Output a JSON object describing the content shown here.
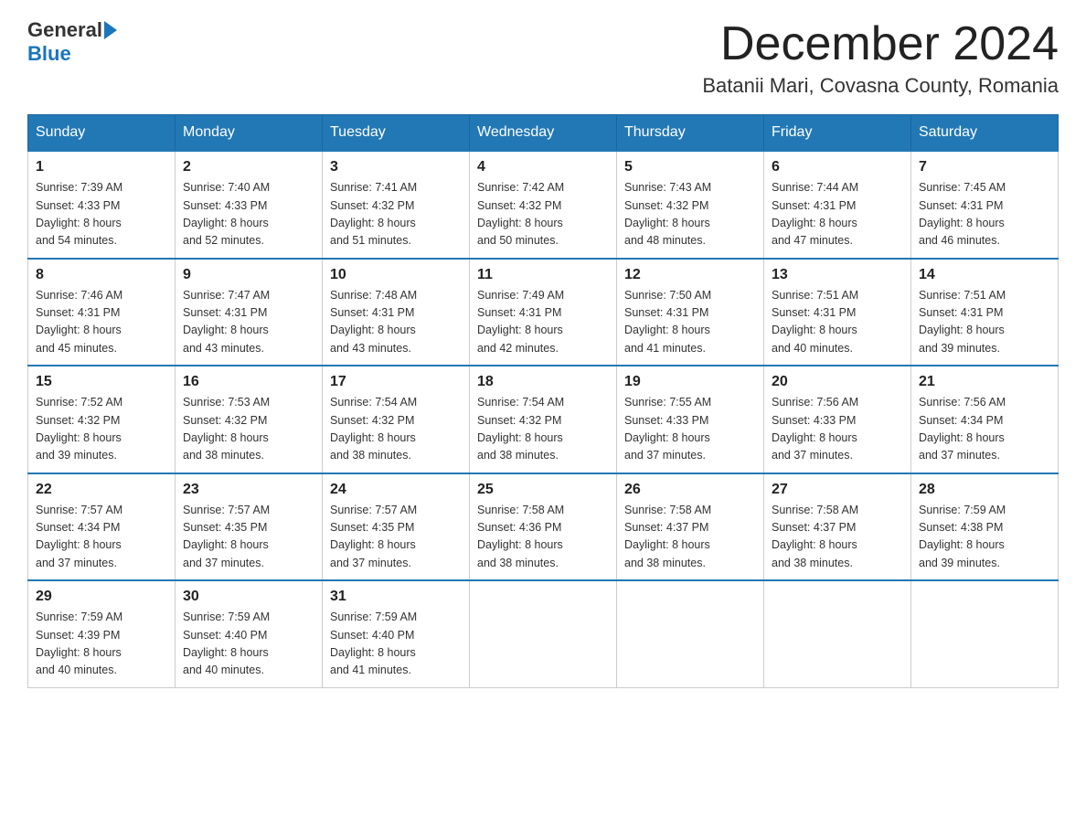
{
  "header": {
    "logo_general": "General",
    "logo_blue": "Blue",
    "month_title": "December 2024",
    "location": "Batanii Mari, Covasna County, Romania"
  },
  "days_of_week": [
    "Sunday",
    "Monday",
    "Tuesday",
    "Wednesday",
    "Thursday",
    "Friday",
    "Saturday"
  ],
  "weeks": [
    [
      {
        "day": "1",
        "sunrise": "7:39 AM",
        "sunset": "4:33 PM",
        "daylight": "8 hours and 54 minutes."
      },
      {
        "day": "2",
        "sunrise": "7:40 AM",
        "sunset": "4:33 PM",
        "daylight": "8 hours and 52 minutes."
      },
      {
        "day": "3",
        "sunrise": "7:41 AM",
        "sunset": "4:32 PM",
        "daylight": "8 hours and 51 minutes."
      },
      {
        "day": "4",
        "sunrise": "7:42 AM",
        "sunset": "4:32 PM",
        "daylight": "8 hours and 50 minutes."
      },
      {
        "day": "5",
        "sunrise": "7:43 AM",
        "sunset": "4:32 PM",
        "daylight": "8 hours and 48 minutes."
      },
      {
        "day": "6",
        "sunrise": "7:44 AM",
        "sunset": "4:31 PM",
        "daylight": "8 hours and 47 minutes."
      },
      {
        "day": "7",
        "sunrise": "7:45 AM",
        "sunset": "4:31 PM",
        "daylight": "8 hours and 46 minutes."
      }
    ],
    [
      {
        "day": "8",
        "sunrise": "7:46 AM",
        "sunset": "4:31 PM",
        "daylight": "8 hours and 45 minutes."
      },
      {
        "day": "9",
        "sunrise": "7:47 AM",
        "sunset": "4:31 PM",
        "daylight": "8 hours and 43 minutes."
      },
      {
        "day": "10",
        "sunrise": "7:48 AM",
        "sunset": "4:31 PM",
        "daylight": "8 hours and 43 minutes."
      },
      {
        "day": "11",
        "sunrise": "7:49 AM",
        "sunset": "4:31 PM",
        "daylight": "8 hours and 42 minutes."
      },
      {
        "day": "12",
        "sunrise": "7:50 AM",
        "sunset": "4:31 PM",
        "daylight": "8 hours and 41 minutes."
      },
      {
        "day": "13",
        "sunrise": "7:51 AM",
        "sunset": "4:31 PM",
        "daylight": "8 hours and 40 minutes."
      },
      {
        "day": "14",
        "sunrise": "7:51 AM",
        "sunset": "4:31 PM",
        "daylight": "8 hours and 39 minutes."
      }
    ],
    [
      {
        "day": "15",
        "sunrise": "7:52 AM",
        "sunset": "4:32 PM",
        "daylight": "8 hours and 39 minutes."
      },
      {
        "day": "16",
        "sunrise": "7:53 AM",
        "sunset": "4:32 PM",
        "daylight": "8 hours and 38 minutes."
      },
      {
        "day": "17",
        "sunrise": "7:54 AM",
        "sunset": "4:32 PM",
        "daylight": "8 hours and 38 minutes."
      },
      {
        "day": "18",
        "sunrise": "7:54 AM",
        "sunset": "4:32 PM",
        "daylight": "8 hours and 38 minutes."
      },
      {
        "day": "19",
        "sunrise": "7:55 AM",
        "sunset": "4:33 PM",
        "daylight": "8 hours and 37 minutes."
      },
      {
        "day": "20",
        "sunrise": "7:56 AM",
        "sunset": "4:33 PM",
        "daylight": "8 hours and 37 minutes."
      },
      {
        "day": "21",
        "sunrise": "7:56 AM",
        "sunset": "4:34 PM",
        "daylight": "8 hours and 37 minutes."
      }
    ],
    [
      {
        "day": "22",
        "sunrise": "7:57 AM",
        "sunset": "4:34 PM",
        "daylight": "8 hours and 37 minutes."
      },
      {
        "day": "23",
        "sunrise": "7:57 AM",
        "sunset": "4:35 PM",
        "daylight": "8 hours and 37 minutes."
      },
      {
        "day": "24",
        "sunrise": "7:57 AM",
        "sunset": "4:35 PM",
        "daylight": "8 hours and 37 minutes."
      },
      {
        "day": "25",
        "sunrise": "7:58 AM",
        "sunset": "4:36 PM",
        "daylight": "8 hours and 38 minutes."
      },
      {
        "day": "26",
        "sunrise": "7:58 AM",
        "sunset": "4:37 PM",
        "daylight": "8 hours and 38 minutes."
      },
      {
        "day": "27",
        "sunrise": "7:58 AM",
        "sunset": "4:37 PM",
        "daylight": "8 hours and 38 minutes."
      },
      {
        "day": "28",
        "sunrise": "7:59 AM",
        "sunset": "4:38 PM",
        "daylight": "8 hours and 39 minutes."
      }
    ],
    [
      {
        "day": "29",
        "sunrise": "7:59 AM",
        "sunset": "4:39 PM",
        "daylight": "8 hours and 40 minutes."
      },
      {
        "day": "30",
        "sunrise": "7:59 AM",
        "sunset": "4:40 PM",
        "daylight": "8 hours and 40 minutes."
      },
      {
        "day": "31",
        "sunrise": "7:59 AM",
        "sunset": "4:40 PM",
        "daylight": "8 hours and 41 minutes."
      },
      null,
      null,
      null,
      null
    ]
  ],
  "labels": {
    "sunrise": "Sunrise:",
    "sunset": "Sunset:",
    "daylight": "Daylight:"
  }
}
